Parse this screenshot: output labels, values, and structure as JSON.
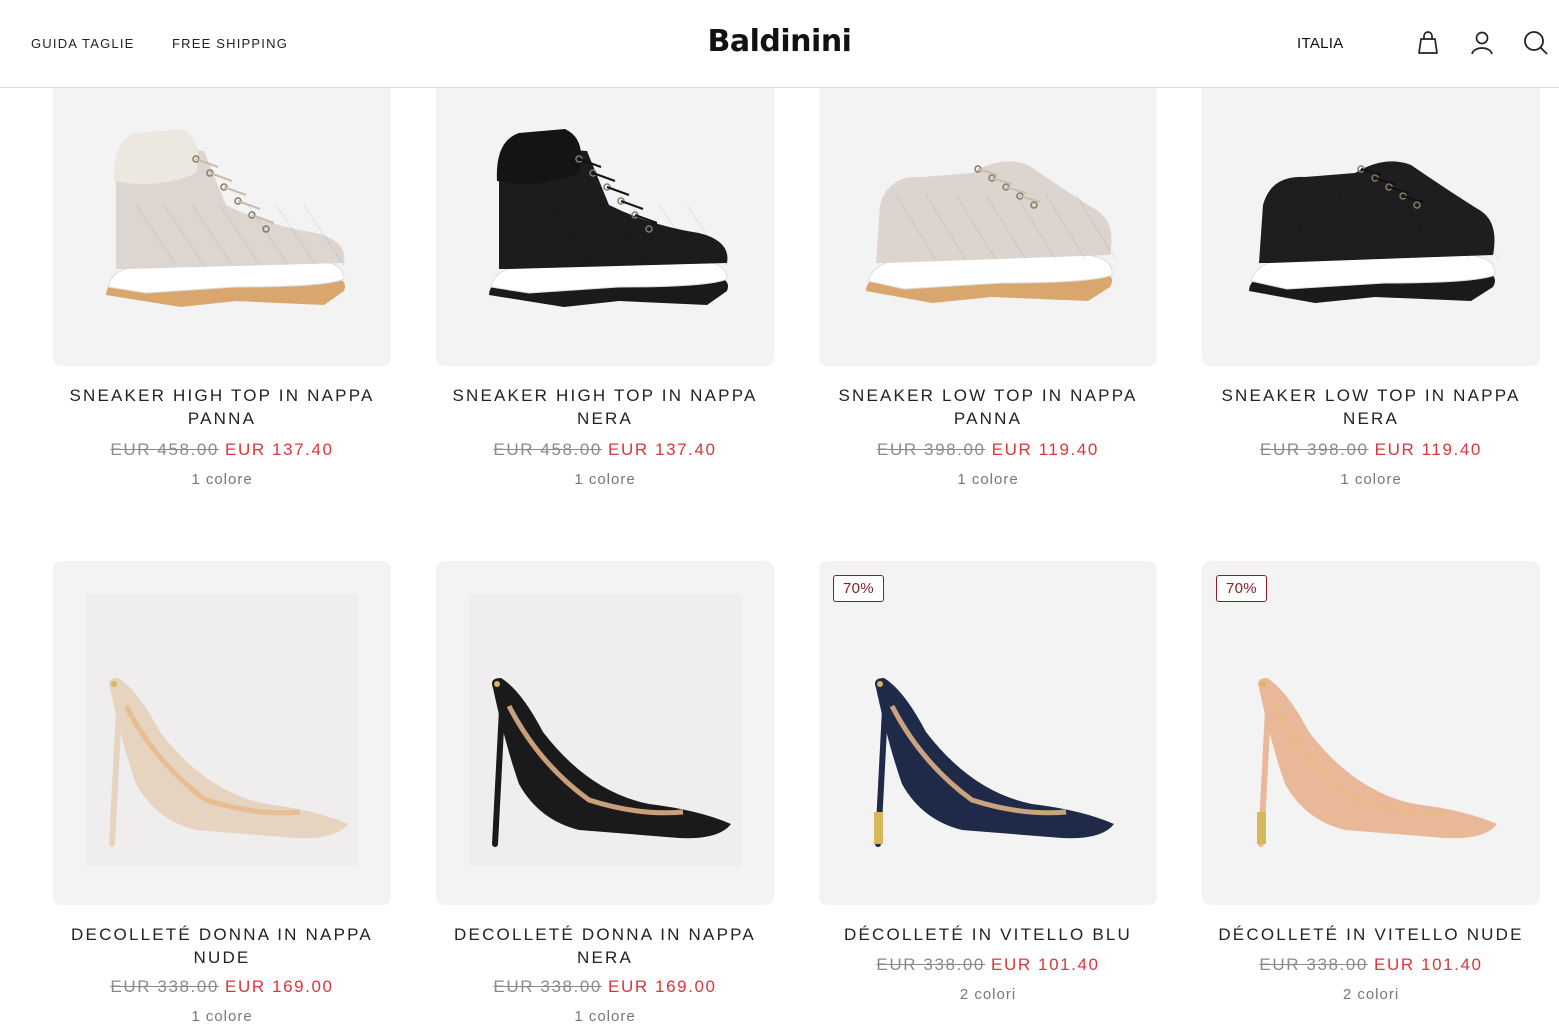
{
  "header": {
    "nav": {
      "size_guide": "GUIDA TAGLIE",
      "free_shipping": "FREE SHIPPING"
    },
    "logo": "Baldinini",
    "country": "ITALIA",
    "icons": {
      "bag": "shopping-bag-icon",
      "account": "user-account-icon",
      "search": "search-icon"
    }
  },
  "products": [
    {
      "title": "SNEAKER HIGH TOP IN NAPPA PANNA",
      "old_price": "EUR 458.00",
      "price": "EUR 137.40",
      "colors": "1 colore",
      "badge": "",
      "shoe_color": "#ddd6d0"
    },
    {
      "title": "SNEAKER HIGH TOP IN NAPPA NERA",
      "old_price": "EUR 458.00",
      "price": "EUR 137.40",
      "colors": "1 colore",
      "badge": "",
      "shoe_color": "#1c1c1e"
    },
    {
      "title": "SNEAKER LOW TOP IN NAPPA PANNA",
      "old_price": "EUR 398.00",
      "price": "EUR 119.40",
      "colors": "1 colore",
      "badge": "",
      "shoe_color": "#dcd5cf"
    },
    {
      "title": "SNEAKER LOW TOP IN NAPPA NERA",
      "old_price": "EUR 398.00",
      "price": "EUR 119.40",
      "colors": "1 colore",
      "badge": "",
      "shoe_color": "#1e1e20"
    },
    {
      "title": "DECOLLETÉ DONNA IN NAPPA NUDE",
      "old_price": "EUR 338.00",
      "price": "EUR 169.00",
      "colors": "1 colore",
      "badge": "",
      "shoe_color": "#e6d3c0"
    },
    {
      "title": "DECOLLETÉ DONNA IN NAPPA NERA",
      "old_price": "EUR 338.00",
      "price": "EUR 169.00",
      "colors": "1 colore",
      "badge": "",
      "shoe_color": "#1a1a1c"
    },
    {
      "title": "DÉCOLLETÉ IN VITELLO BLU",
      "old_price": "EUR 338.00",
      "price": "EUR 101.40",
      "colors": "2 colori",
      "badge": "70%",
      "shoe_color": "#1f2a48"
    },
    {
      "title": "DÉCOLLETÉ IN VITELLO NUDE",
      "old_price": "EUR 338.00",
      "price": "EUR 101.40",
      "colors": "2 colori",
      "badge": "70%",
      "shoe_color": "#e9b898"
    }
  ],
  "colors": {
    "sale_price": "#d9363e",
    "badge_border": "#8a1f2b",
    "card_bg": "#f4f3f3"
  }
}
